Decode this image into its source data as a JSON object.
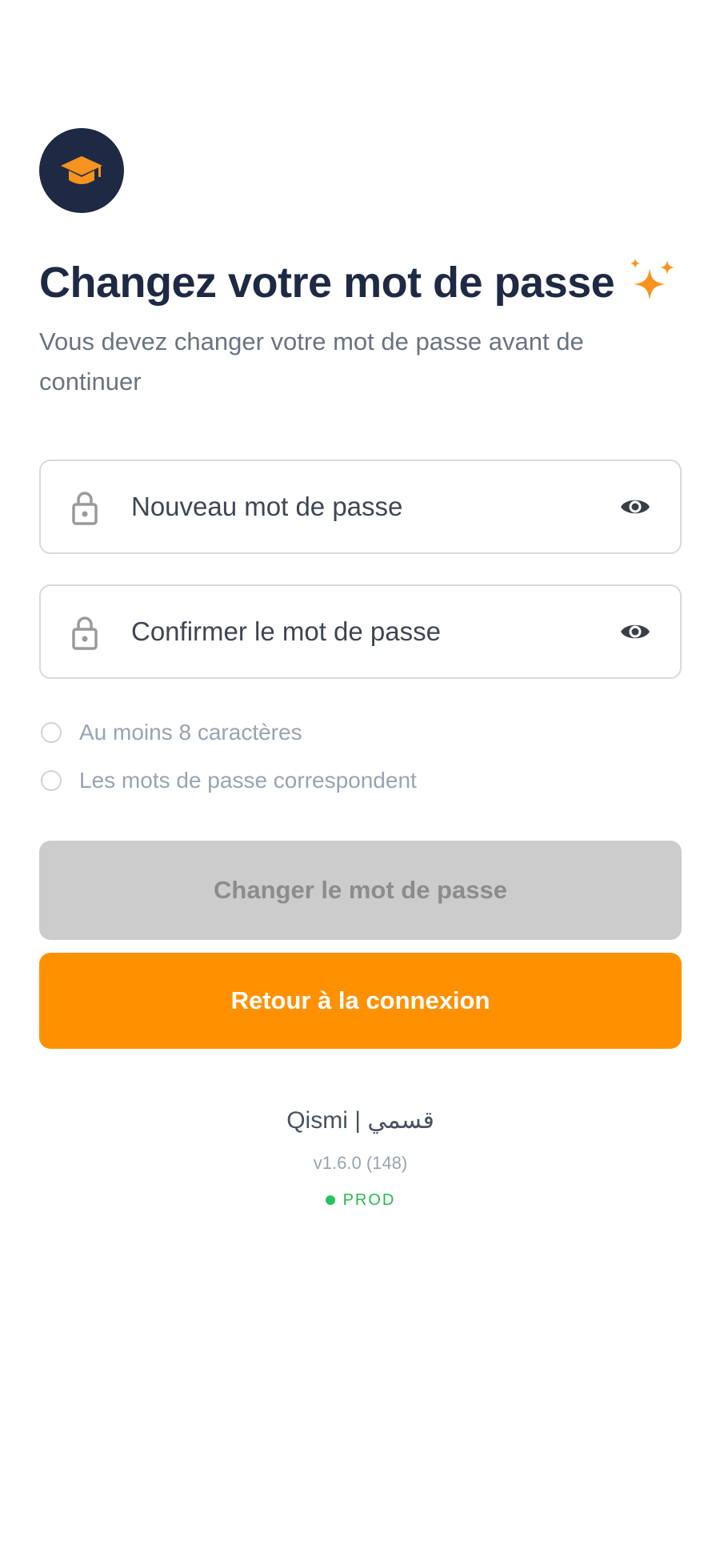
{
  "header": {
    "logo_icon": "graduation-cap-icon",
    "title": "Changez votre mot de passe",
    "title_decoration": "sparkles-icon",
    "subtitle": "Vous devez changer votre mot de passe avant de continuer"
  },
  "form": {
    "new_password": {
      "placeholder": "Nouveau mot de passe",
      "leading_icon": "lock-icon",
      "trailing_icon": "eye-icon"
    },
    "confirm_password": {
      "placeholder": "Confirmer le mot de passe",
      "leading_icon": "lock-icon",
      "trailing_icon": "eye-icon"
    },
    "rules": [
      {
        "label": "Au moins 8 caractères",
        "met": false
      },
      {
        "label": "Les mots de passe correspondent",
        "met": false
      }
    ]
  },
  "actions": {
    "change_label": "Changer le mot de passe",
    "change_disabled": true,
    "back_label": "Retour à la connexion"
  },
  "footer": {
    "brand": "Qismi | قسمي",
    "version": "v1.6.0 (148)",
    "environment": "PROD"
  },
  "colors": {
    "navy": "#1e2a44",
    "accent_orange": "#ff9100",
    "disabled_gray": "#cccccc",
    "status_green": "#22c55e"
  }
}
